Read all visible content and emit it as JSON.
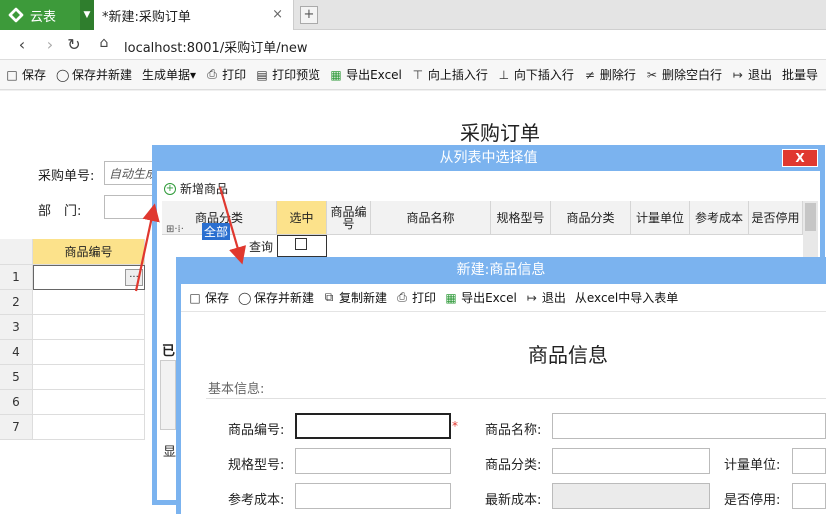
{
  "browser": {
    "app_name": "云表",
    "tab_title": "*新建:采购订单",
    "tab_close": "×",
    "new_tab": "+",
    "url": "localhost:8001/采购订单/new"
  },
  "toolbar": {
    "items": [
      "保存",
      "保存并新建",
      "生成单据▾",
      "打印",
      "打印预览",
      "导出Excel",
      "向上插入行",
      "向下插入行",
      "删除行",
      "删除空白行",
      "退出",
      "批量导"
    ]
  },
  "form": {
    "title": "采购订单",
    "order_no_label": "采购单号:",
    "order_no_value": "自动生成",
    "dept_label": "部　门:",
    "grid_header": "商品编号",
    "row_numbers": [
      "1",
      "2",
      "3",
      "4",
      "5",
      "6",
      "7"
    ],
    "ellipsis": "···"
  },
  "dialog_list": {
    "title": "从列表中选择值",
    "close_label": "X",
    "add_product": "新增商品",
    "category_header": "商品分类",
    "tree_all": "全部",
    "query": "查询",
    "columns": [
      "选中",
      "商品编号",
      "商品名称",
      "规格型号",
      "商品分类",
      "计量单位",
      "参考成本",
      "是否停用"
    ],
    "fragment_1": "已",
    "fragment_2": "显"
  },
  "dialog_product": {
    "title": "新建:商品信息",
    "toolbar": [
      "保存",
      "保存并新建",
      "复制新建",
      "打印",
      "导出Excel",
      "退出",
      "从excel中导入表单"
    ],
    "heading": "商品信息",
    "section": "基本信息:",
    "fields": {
      "code": "商品编号:",
      "name": "商品名称:",
      "spec": "规格型号:",
      "category": "商品分类:",
      "unit": "计量单位:",
      "ref_cost": "参考成本:",
      "latest_cost": "最新成本:",
      "disabled": "是否停用:"
    },
    "required_mark": "*"
  }
}
